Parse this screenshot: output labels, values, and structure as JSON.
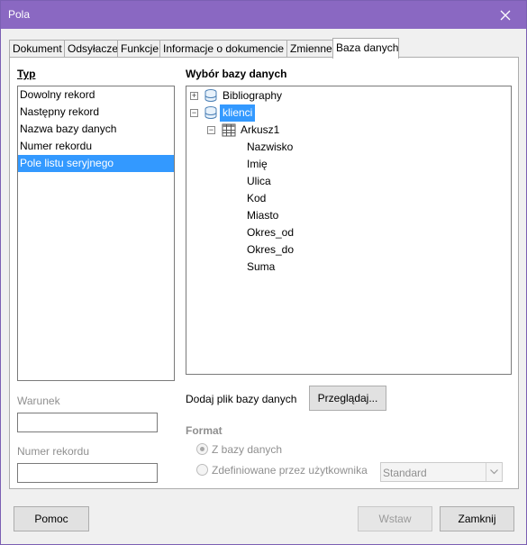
{
  "window": {
    "title": "Pola"
  },
  "tabs": [
    {
      "label": "Dokument",
      "active": false
    },
    {
      "label": "Odsyłacze",
      "active": false
    },
    {
      "label": "Funkcje",
      "active": false
    },
    {
      "label": "Informacje o dokumencie",
      "active": false
    },
    {
      "label": "Zmienne",
      "active": false
    },
    {
      "label": "Baza danych",
      "active": true
    }
  ],
  "type_section": {
    "heading": "Typ",
    "items": [
      "Dowolny rekord",
      "Następny rekord",
      "Nazwa bazy danych",
      "Numer rekordu",
      "Pole listu seryjnego"
    ],
    "selected_index": 4
  },
  "condition": {
    "label": "Warunek",
    "value": ""
  },
  "record_number": {
    "label": "Numer rekordu",
    "value": ""
  },
  "db_selection": {
    "heading": "Wybór bazy danych",
    "tree": [
      {
        "label": "Bibliography",
        "expander": "+"
      },
      {
        "label": "klienci",
        "expander": "−"
      },
      {
        "label": "Arkusz1",
        "expander": "−"
      },
      {
        "label": "Nazwisko"
      },
      {
        "label": "Imię"
      },
      {
        "label": "Ulica"
      },
      {
        "label": "Kod"
      },
      {
        "label": "Miasto"
      },
      {
        "label": "Okres_od"
      },
      {
        "label": "Okres_do"
      },
      {
        "label": "Suma"
      }
    ]
  },
  "add_db": {
    "label": "Dodaj plik bazy danych",
    "browse_button": "Przeglądaj..."
  },
  "format": {
    "heading": "Format",
    "option_db": "Z bazy danych",
    "option_user": "Zdefiniowane przez użytkownika",
    "combo_value": "Standard"
  },
  "buttons": {
    "help": "Pomoc",
    "insert": "Wstaw",
    "close": "Zamknij"
  },
  "colors": {
    "titlebar": "#8a68c2",
    "selection": "#3399ff"
  }
}
